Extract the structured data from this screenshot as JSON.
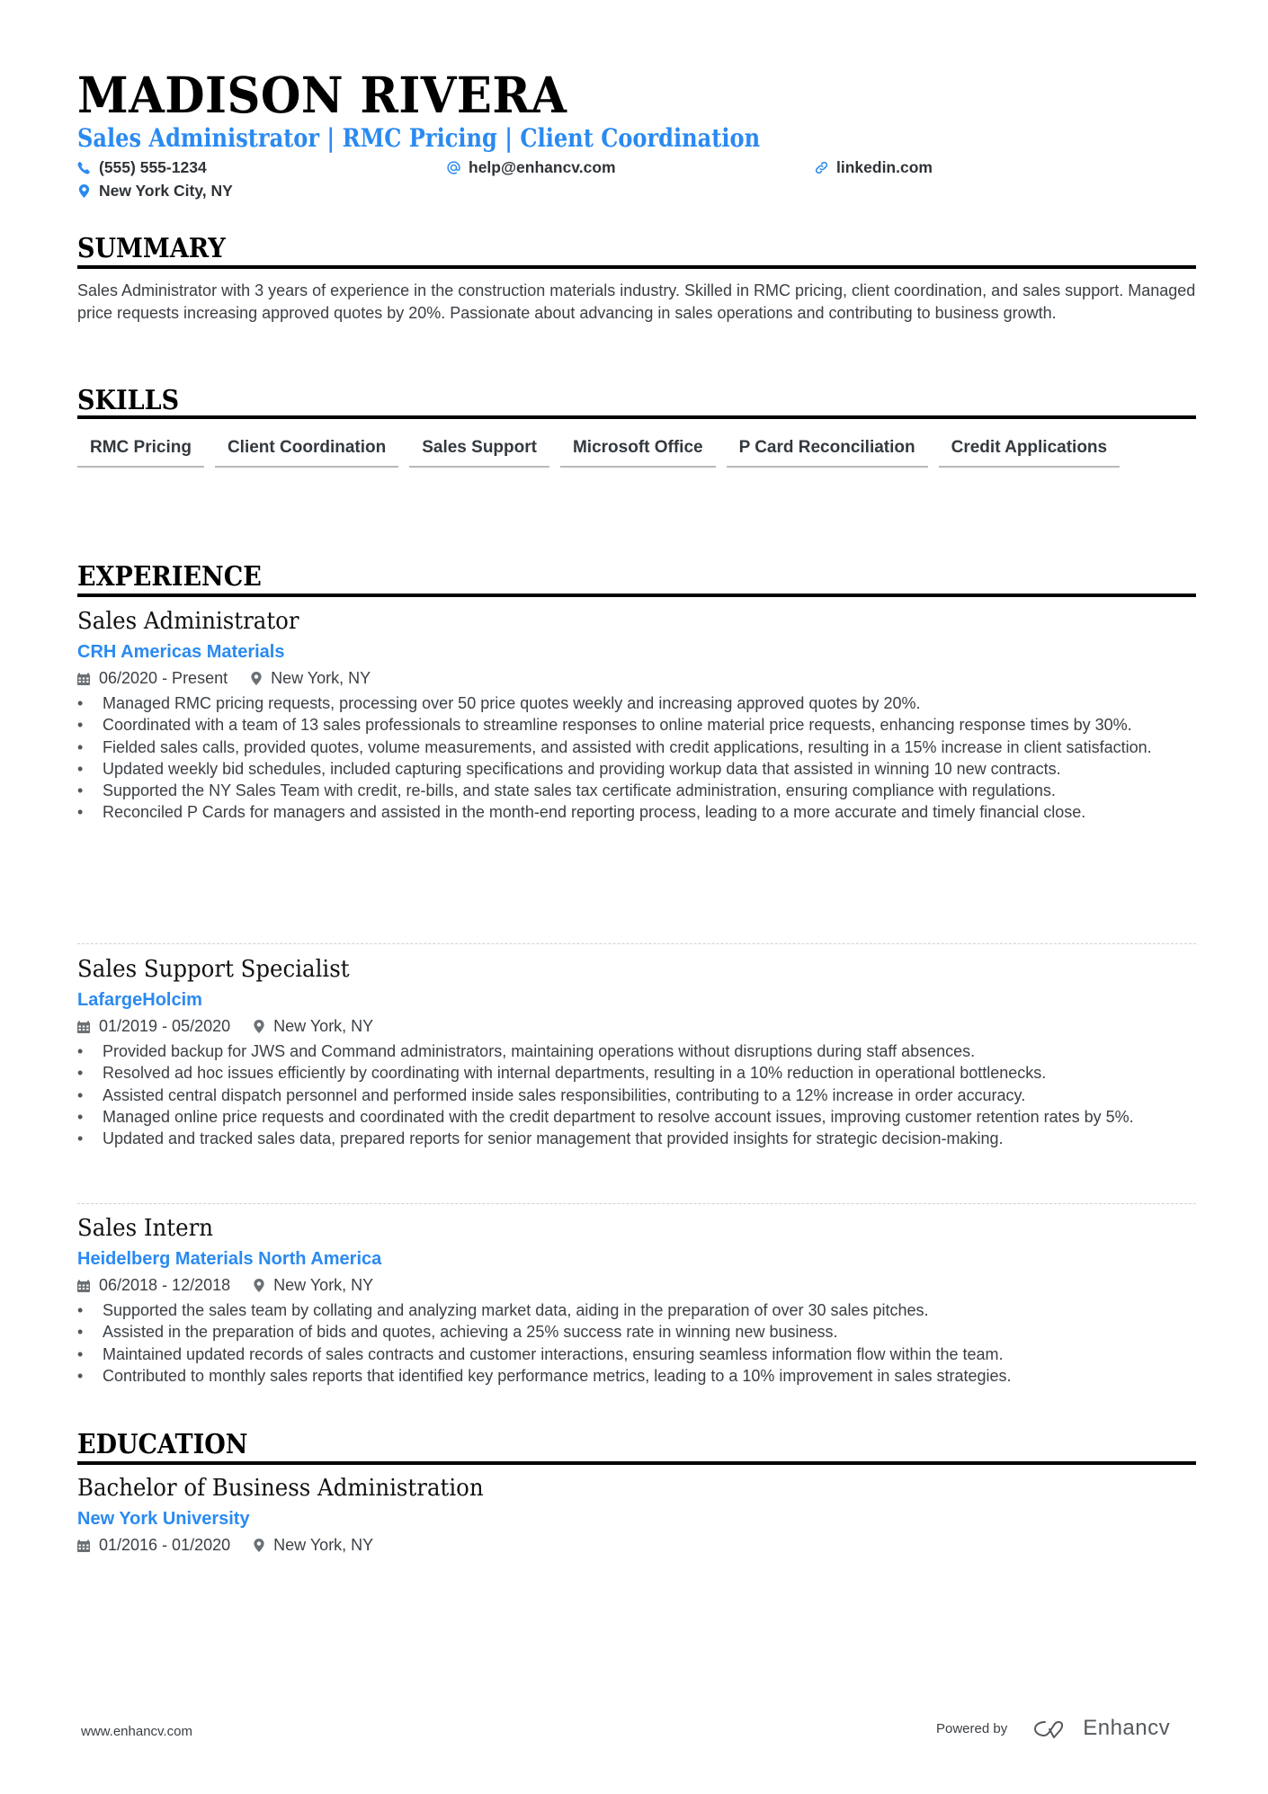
{
  "header": {
    "name": "MADISON RIVERA",
    "headline": "Sales Administrator | RMC Pricing | Client Coordination",
    "contacts": {
      "phone": {
        "icon": "phone-icon",
        "value": "(555) 555-1234"
      },
      "email": {
        "icon": "at-icon",
        "value": "help@enhancv.com"
      },
      "website": {
        "icon": "link-icon",
        "value": "linkedin.com"
      },
      "location": {
        "icon": "map-pin-icon",
        "value": "New York City, NY"
      }
    }
  },
  "colors": {
    "accent": "#2a8af0",
    "heading": "#000000",
    "text": "#3b4045",
    "divider": "#cfd1d3"
  },
  "summary": {
    "title": "SUMMARY",
    "text": "Sales Administrator with 3 years of experience in the construction materials industry. Skilled in RMC pricing, client coordination, and sales support. Managed price requests increasing approved quotes by 20%. Passionate about advancing in sales operations and contributing to business growth."
  },
  "skills": {
    "title": "SKILLS",
    "items": [
      "RMC Pricing",
      "Client Coordination",
      "Sales Support",
      "Microsoft Office",
      "P Card Reconciliation",
      "Credit Applications"
    ]
  },
  "experience": {
    "title": "EXPERIENCE",
    "jobs": [
      {
        "title": "Sales Administrator",
        "company": "CRH Americas Materials",
        "dates": "06/2020 - Present",
        "location": "New York, NY",
        "bullets": [
          "Managed RMC pricing requests, processing over 50 price quotes weekly and increasing approved quotes by 20%.",
          "Coordinated with a team of 13 sales professionals to streamline responses to online material price requests, enhancing response times by 30%.",
          "Fielded sales calls, provided quotes, volume measurements, and assisted with credit applications, resulting in a 15% increase in client satisfaction.",
          "Updated weekly bid schedules, included capturing specifications and providing workup data that assisted in winning 10 new contracts.",
          "Supported the NY Sales Team with credit, re-bills, and state sales tax certificate administration, ensuring compliance with regulations.",
          "Reconciled P Cards for managers and assisted in the month-end reporting process, leading to a more accurate and timely financial close."
        ]
      },
      {
        "title": "Sales Support Specialist",
        "company": "LafargeHolcim",
        "dates": "01/2019 - 05/2020",
        "location": "New York, NY",
        "bullets": [
          "Provided backup for JWS and Command administrators, maintaining operations without disruptions during staff absences.",
          "Resolved ad hoc issues efficiently by coordinating with internal departments, resulting in a 10% reduction in operational bottlenecks.",
          "Assisted central dispatch personnel and performed inside sales responsibilities, contributing to a 12% increase in order accuracy.",
          "Managed online price requests and coordinated with the credit department to resolve account issues, improving customer retention rates by 5%.",
          "Updated and tracked sales data, prepared reports for senior management that provided insights for strategic decision-making."
        ]
      },
      {
        "title": "Sales Intern",
        "company": "Heidelberg Materials North America",
        "dates": "06/2018 - 12/2018",
        "location": "New York, NY",
        "bullets": [
          "Supported the sales team by collating and analyzing market data, aiding in the preparation of over 30 sales pitches.",
          "Assisted in the preparation of bids and quotes, achieving a 25% success rate in winning new business.",
          "Maintained updated records of sales contracts and customer interactions, ensuring seamless information flow within the team.",
          "Contributed to monthly sales reports that identified key performance metrics, leading to a 10% improvement in sales strategies."
        ]
      }
    ]
  },
  "education": {
    "title": "EDUCATION",
    "items": [
      {
        "degree": "Bachelor of Business Administration",
        "school": "New York University",
        "dates": "01/2016 - 01/2020",
        "location": "New York, NY"
      }
    ]
  },
  "footer": {
    "website": "www.enhancv.com",
    "powered_by": "Powered by",
    "brand": "Enhancv",
    "brand_icon": "enhancv-logo-icon"
  }
}
